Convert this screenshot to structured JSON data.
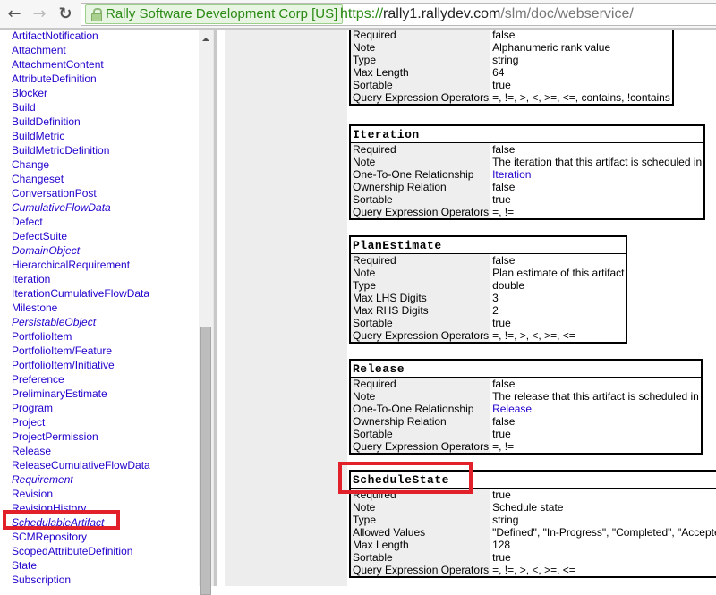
{
  "browser": {
    "back_icon": "arrow-left-icon",
    "forward_icon": "arrow-right-icon",
    "reload_icon": "reload-icon",
    "ev_label": "Rally Software Development Corp [US]",
    "url_scheme": "https://",
    "url_host": "rally1.rallydev.com",
    "url_path": "/slm/doc/webservice/"
  },
  "sidebar": {
    "items": [
      {
        "label": "ArtifactNotification",
        "italic": false
      },
      {
        "label": "Attachment",
        "italic": false
      },
      {
        "label": "AttachmentContent",
        "italic": false
      },
      {
        "label": "AttributeDefinition",
        "italic": false
      },
      {
        "label": "Blocker",
        "italic": false
      },
      {
        "label": "Build",
        "italic": false
      },
      {
        "label": "BuildDefinition",
        "italic": false
      },
      {
        "label": "BuildMetric",
        "italic": false
      },
      {
        "label": "BuildMetricDefinition",
        "italic": false
      },
      {
        "label": "Change",
        "italic": false
      },
      {
        "label": "Changeset",
        "italic": false
      },
      {
        "label": "ConversationPost",
        "italic": false
      },
      {
        "label": "CumulativeFlowData",
        "italic": true
      },
      {
        "label": "Defect",
        "italic": false
      },
      {
        "label": "DefectSuite",
        "italic": false
      },
      {
        "label": "DomainObject",
        "italic": true
      },
      {
        "label": "HierarchicalRequirement",
        "italic": false
      },
      {
        "label": "Iteration",
        "italic": false
      },
      {
        "label": "IterationCumulativeFlowData",
        "italic": false
      },
      {
        "label": "Milestone",
        "italic": false
      },
      {
        "label": "PersistableObject",
        "italic": true
      },
      {
        "label": "PortfolioItem",
        "italic": false
      },
      {
        "label": "PortfolioItem/Feature",
        "italic": false
      },
      {
        "label": "PortfolioItem/Initiative",
        "italic": false
      },
      {
        "label": "Preference",
        "italic": false
      },
      {
        "label": "PreliminaryEstimate",
        "italic": false
      },
      {
        "label": "Program",
        "italic": false
      },
      {
        "label": "Project",
        "italic": false
      },
      {
        "label": "ProjectPermission",
        "italic": false
      },
      {
        "label": "Release",
        "italic": false
      },
      {
        "label": "ReleaseCumulativeFlowData",
        "italic": false
      },
      {
        "label": "Requirement",
        "italic": true
      },
      {
        "label": "Revision",
        "italic": false
      },
      {
        "label": "RevisionHistory",
        "italic": false
      },
      {
        "label": "SchedulableArtifact",
        "italic": true,
        "highlighted": true
      },
      {
        "label": "SCMRepository",
        "italic": false
      },
      {
        "label": "ScopedAttributeDefinition",
        "italic": false
      },
      {
        "label": "State",
        "italic": false
      },
      {
        "label": "Subscription",
        "italic": false
      }
    ]
  },
  "attributes": [
    {
      "name": "",
      "rows": [
        {
          "key": "Required",
          "value": "false"
        },
        {
          "key": "Note",
          "value": "Alphanumeric rank value"
        },
        {
          "key": "Type",
          "value": "string"
        },
        {
          "key": "Max Length",
          "value": "64"
        },
        {
          "key": "Sortable",
          "value": "true"
        },
        {
          "key": "Query Expression Operators",
          "value": "=, !=, >, <, >=, <=, contains, !contains"
        }
      ]
    },
    {
      "name": "Iteration",
      "rows": [
        {
          "key": "Required",
          "value": "false"
        },
        {
          "key": "Note",
          "value": "The iteration that this artifact is scheduled in"
        },
        {
          "key": "One-To-One Relationship",
          "value": "Iteration",
          "link": true
        },
        {
          "key": "Ownership Relation",
          "value": "false"
        },
        {
          "key": "Sortable",
          "value": "true"
        },
        {
          "key": "Query Expression Operators",
          "value": "=, !="
        }
      ]
    },
    {
      "name": "PlanEstimate",
      "rows": [
        {
          "key": "Required",
          "value": "false"
        },
        {
          "key": "Note",
          "value": "Plan estimate of this artifact"
        },
        {
          "key": "Type",
          "value": "double"
        },
        {
          "key": "Max LHS Digits",
          "value": "3"
        },
        {
          "key": "Max RHS Digits",
          "value": "2"
        },
        {
          "key": "Sortable",
          "value": "true"
        },
        {
          "key": "Query Expression Operators",
          "value": "=, !=, >, <, >=, <="
        }
      ]
    },
    {
      "name": "Release",
      "rows": [
        {
          "key": "Required",
          "value": "false"
        },
        {
          "key": "Note",
          "value": "The release that this artifact is scheduled in"
        },
        {
          "key": "One-To-One Relationship",
          "value": "Release",
          "link": true
        },
        {
          "key": "Ownership Relation",
          "value": "false"
        },
        {
          "key": "Sortable",
          "value": "true"
        },
        {
          "key": "Query Expression Operators",
          "value": "=, !="
        }
      ]
    },
    {
      "name": "ScheduleState",
      "highlighted": true,
      "rows": [
        {
          "key": "Required",
          "value": "true"
        },
        {
          "key": "Note",
          "value": "Schedule state"
        },
        {
          "key": "Type",
          "value": "string"
        },
        {
          "key": "Allowed Values",
          "value": "\"Defined\", \"In-Progress\", \"Completed\", \"Accepted\""
        },
        {
          "key": "Max Length",
          "value": "128"
        },
        {
          "key": "Sortable",
          "value": "true"
        },
        {
          "key": "Query Expression Operators",
          "value": "=, !=, >, <, >=, <="
        }
      ]
    }
  ],
  "colors": {
    "link": "#2200cc",
    "highlight": "#e2202a",
    "ev_green": "#2a8a14"
  }
}
